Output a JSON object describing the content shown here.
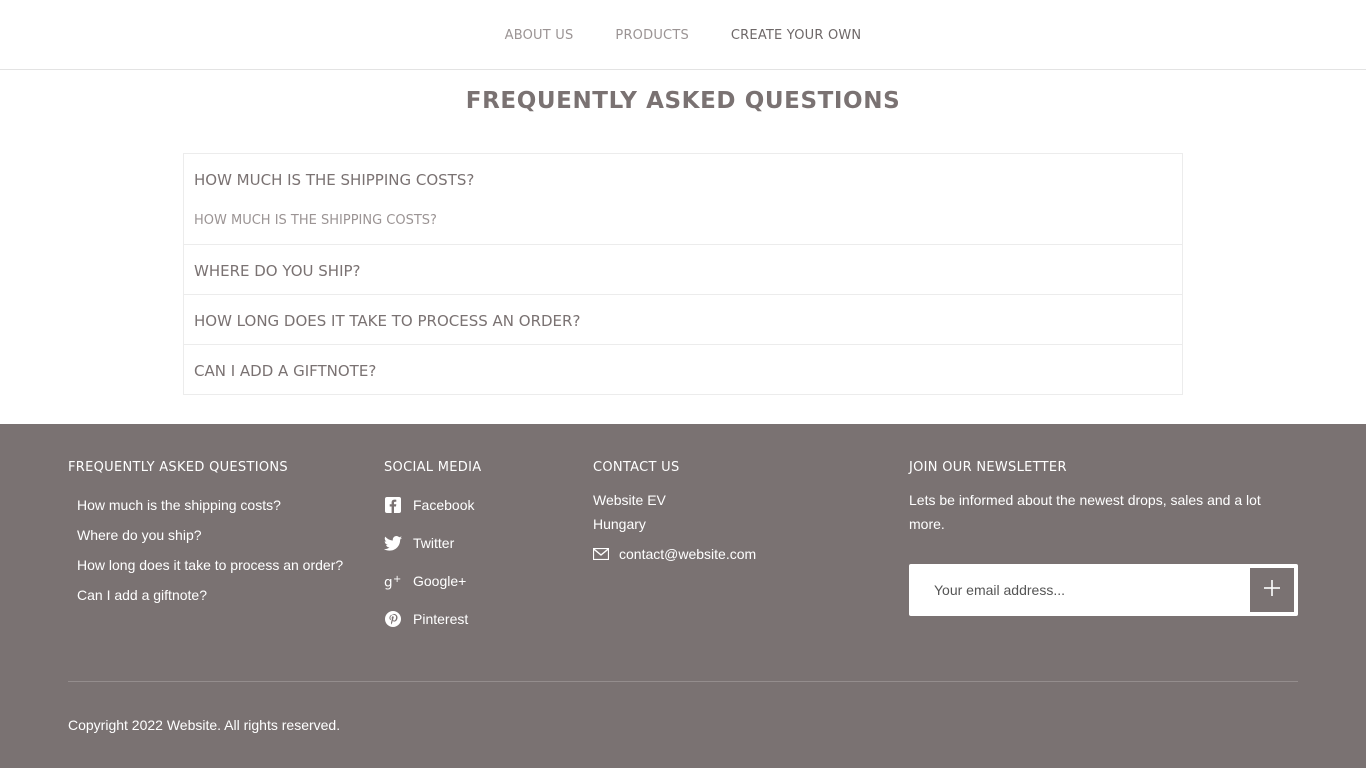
{
  "nav": {
    "items": [
      {
        "label": "ABOUT US"
      },
      {
        "label": "PRODUCTS"
      },
      {
        "label": "CREATE YOUR OWN"
      }
    ]
  },
  "faq": {
    "title": "FREQUENTLY ASKED QUESTIONS",
    "items": [
      {
        "question": "HOW MUCH IS THE SHIPPING COSTS?",
        "answer": "HOW MUCH IS THE SHIPPING COSTS?",
        "expanded": true
      },
      {
        "question": "WHERE DO YOU SHIP?",
        "expanded": false
      },
      {
        "question": "HOW LONG DOES IT TAKE TO PROCESS AN ORDER?",
        "expanded": false
      },
      {
        "question": "CAN I ADD A GIFTNOTE?",
        "expanded": false
      }
    ]
  },
  "footer": {
    "faq": {
      "heading": "FREQUENTLY ASKED QUESTIONS",
      "links": [
        "How much is the shipping costs?",
        "Where do you ship?",
        "How long does it take to process an order?",
        "Can I add a giftnote?"
      ]
    },
    "social": {
      "heading": "SOCIAL MEDIA",
      "items": [
        {
          "label": "Facebook",
          "icon": "facebook-icon"
        },
        {
          "label": "Twitter",
          "icon": "twitter-icon"
        },
        {
          "label": "Google+",
          "icon": "google-plus-icon"
        },
        {
          "label": "Pinterest",
          "icon": "pinterest-icon"
        }
      ]
    },
    "contact": {
      "heading": "CONTACT US",
      "company": "Website EV",
      "country": "Hungary",
      "email": "contact@website.com",
      "email_icon": "envelope-icon"
    },
    "newsletter": {
      "heading": "JOIN OUR NEWSLETTER",
      "text": "Lets be informed about the newest drops, sales and a lot more.",
      "placeholder": "Your email address...",
      "submit_icon": "plus-icon"
    },
    "copyright": "Copyright 2022 Website. All rights reserved."
  },
  "colors": {
    "footer_bg": "#7a7272",
    "text": "#7a7272",
    "muted": "#9b9494"
  }
}
